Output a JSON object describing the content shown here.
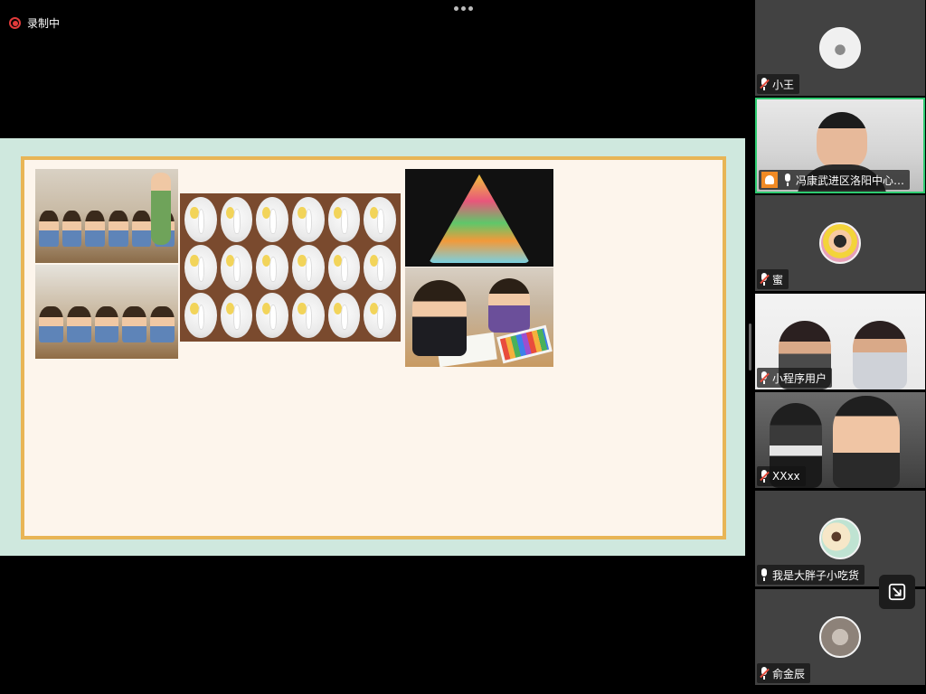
{
  "recording": {
    "label": "录制中",
    "color": "#e23a3a"
  },
  "toolbar": {
    "more_icon": "more-dots-icon"
  },
  "shared_screen": {
    "frame_color": "#cfe8de",
    "border_color": "#e8b556",
    "photos": [
      "classroom-photo",
      "classroom-photo",
      "bunny-plates-artwork",
      "cupcake-tree-poster",
      "children-drawing-photo"
    ]
  },
  "participants": [
    {
      "name": "小王",
      "mic": "muted",
      "type": "avatar",
      "avatar": "cat-avatar"
    },
    {
      "name": "冯康武进区洛阳中心…",
      "mic": "on",
      "type": "video",
      "host": true,
      "active": true,
      "active_color": "#2ecc71"
    },
    {
      "name": "蜜",
      "mic": "muted",
      "type": "avatar",
      "avatar": "girl-avatar"
    },
    {
      "name": "小程序用户",
      "mic": "muted",
      "type": "video"
    },
    {
      "name": "XXxx",
      "mic": "muted",
      "type": "video"
    },
    {
      "name": "我是大胖子小吃货",
      "mic": "on",
      "type": "avatar",
      "avatar": "plant-avatar"
    },
    {
      "name": "俞金辰",
      "mic": "muted",
      "type": "avatar",
      "avatar": "mic-photo-avatar"
    }
  ],
  "floating_button": {
    "icon": "exit-fullscreen-icon"
  }
}
